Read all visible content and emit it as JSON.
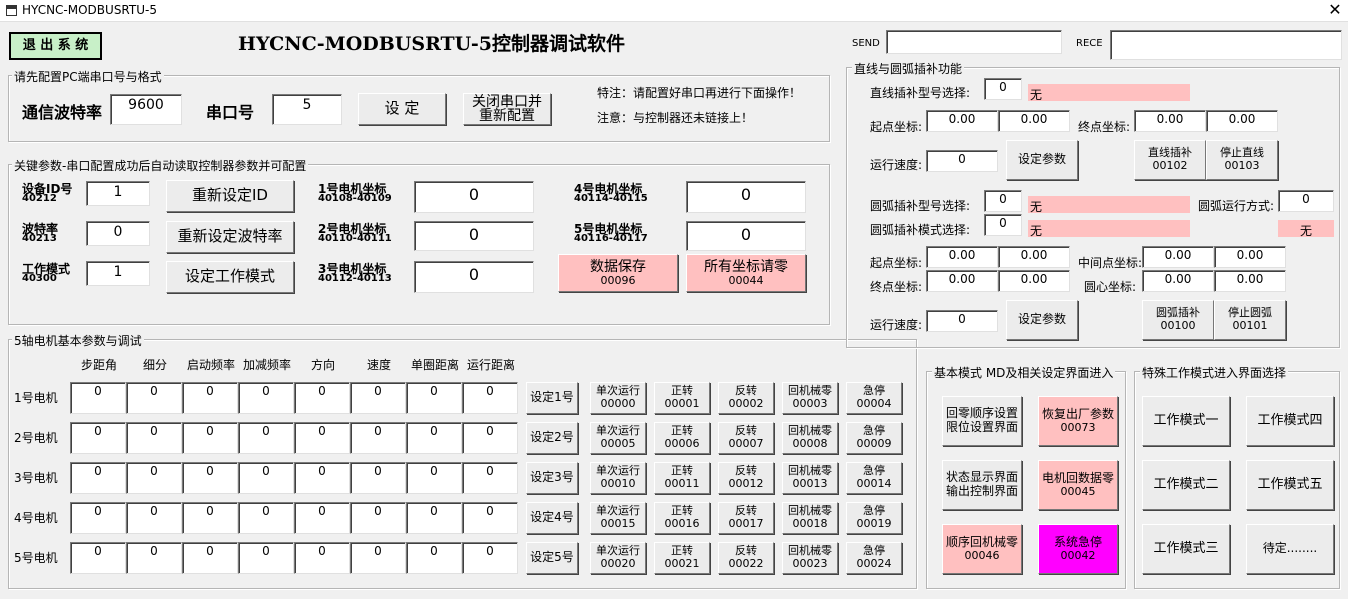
{
  "window": {
    "title": "HYCNC-MODBUSRTU-5",
    "close": "✕"
  },
  "header": {
    "exit": "退 出 系 统",
    "app_title": "HYCNC-MODBUSRTU-5控制器调试软件",
    "send": "SEND",
    "rece": "RECE"
  },
  "serial": {
    "group": "请先配置PC端串口号与格式",
    "baud_label": "通信波特率",
    "baud_value": "9600",
    "port_label": "串口号",
    "port_value": "5",
    "set_btn": "设 定",
    "close_btn_l1": "关闭串口并",
    "close_btn_l2": "重新配置",
    "note1": "特注：请配置好串口再进行下面操作！",
    "note2": "注意：与控制器还未链接上！"
  },
  "keyparams": {
    "group": "关键参数-串口配置成功后自动读取控制器参数并可配置",
    "id_label": "设备ID号",
    "id_reg": "40212",
    "id_value": "1",
    "id_btn": "重新设定ID",
    "baud_label": "波特率",
    "baud_reg": "40213",
    "baud_value": "0",
    "baud_btn": "重新设定波特率",
    "mode_label": "工作模式",
    "mode_reg": "40300",
    "mode_value": "1",
    "mode_btn": "设定工作模式",
    "m1_label": "1号电机坐标",
    "m1_reg": "40108-40109",
    "m1_value": "0",
    "m2_label": "2号电机坐标",
    "m2_reg": "40110-40111",
    "m2_value": "0",
    "m3_label": "3号电机坐标",
    "m3_reg": "40112-40113",
    "m3_value": "0",
    "m4_label": "4号电机坐标",
    "m4_reg": "40114-40115",
    "m4_value": "0",
    "m5_label": "5号电机坐标",
    "m5_reg": "40116-40117",
    "m5_value": "0",
    "save_btn": "数据保存",
    "save_code": "00096",
    "zero_btn": "所有坐标请零",
    "zero_code": "00044"
  },
  "axis": {
    "group": "5轴电机基本参数与调试",
    "headers": [
      "步距角",
      "细分",
      "启动频率",
      "加减频率",
      "方向",
      "速度",
      "单圈距离",
      "运行距离"
    ],
    "rows": [
      {
        "label": "1号电机",
        "values": [
          "0",
          "0",
          "0",
          "0",
          "0",
          "0",
          "0",
          "0"
        ],
        "set": "设定1号",
        "b1": "单次运行",
        "c1": "00000",
        "b2": "正转",
        "c2": "00001",
        "b3": "反转",
        "c3": "00002",
        "b4": "回机械零",
        "c4": "00003",
        "b5": "急停",
        "c5": "00004"
      },
      {
        "label": "2号电机",
        "values": [
          "0",
          "0",
          "0",
          "0",
          "0",
          "0",
          "0",
          "0"
        ],
        "set": "设定2号",
        "b1": "单次运行",
        "c1": "00005",
        "b2": "正转",
        "c2": "00006",
        "b3": "反转",
        "c3": "00007",
        "b4": "回机械零",
        "c4": "00008",
        "b5": "急停",
        "c5": "00009"
      },
      {
        "label": "3号电机",
        "values": [
          "0",
          "0",
          "0",
          "0",
          "0",
          "0",
          "0",
          "0"
        ],
        "set": "设定3号",
        "b1": "单次运行",
        "c1": "00010",
        "b2": "正转",
        "c2": "00011",
        "b3": "反转",
        "c3": "00012",
        "b4": "回机械零",
        "c4": "00013",
        "b5": "急停",
        "c5": "00014"
      },
      {
        "label": "4号电机",
        "values": [
          "0",
          "0",
          "0",
          "0",
          "0",
          "0",
          "0",
          "0"
        ],
        "set": "设定4号",
        "b1": "单次运行",
        "c1": "00015",
        "b2": "正转",
        "c2": "00016",
        "b3": "反转",
        "c3": "00017",
        "b4": "回机械零",
        "c4": "00018",
        "b5": "急停",
        "c5": "00019"
      },
      {
        "label": "5号电机",
        "values": [
          "0",
          "0",
          "0",
          "0",
          "0",
          "0",
          "0",
          "0"
        ],
        "set": "设定5号",
        "b1": "单次运行",
        "c1": "00020",
        "b2": "正转",
        "c2": "00021",
        "b3": "反转",
        "c3": "00022",
        "b4": "回机械零",
        "c4": "00023",
        "b5": "急停",
        "c5": "00024"
      }
    ]
  },
  "interp": {
    "group": "直线与圆弧插补功能",
    "line_type_label": "直线插补型号选择:",
    "line_type_value": "0",
    "line_type_text": "无",
    "start_label": "起点坐标:",
    "start_x": "0.00",
    "start_y": "0.00",
    "end_label": "终点坐标:",
    "end_x": "0.00",
    "end_y": "0.00",
    "speed_label": "运行速度:",
    "speed_value": "0",
    "setparam_btn": "设定参数",
    "line_btn": "直线插补",
    "line_code": "00102",
    "stopline_btn": "停止直线",
    "stopline_code": "00103",
    "arc_type_label": "圆弧插补型号选择:",
    "arc_type_value": "0",
    "arc_type_text": "无",
    "arc_mode_label": "圆弧插补模式选择:",
    "arc_mode_value": "0",
    "arc_mode_text": "无",
    "arc_run_label": "圆弧运行方式:",
    "arc_run_value": "0",
    "arc_run_text": "无",
    "arc_start_label": "起点坐标:",
    "arc_start_x": "0.00",
    "arc_start_y": "0.00",
    "arc_end_label": "终点坐标:",
    "arc_end_x": "0.00",
    "arc_end_y": "0.00",
    "arc_mid_label": "中间点坐标:",
    "arc_mid_x": "0.00",
    "arc_mid_y": "0.00",
    "arc_center_label": "圆心坐标:",
    "arc_center_x": "0.00",
    "arc_center_y": "0.00",
    "arc_speed_label": "运行速度:",
    "arc_speed_value": "0",
    "arc_setparam_btn": "设定参数",
    "arc_btn": "圆弧插补",
    "arc_code": "00100",
    "stoparc_btn": "停止圆弧",
    "stoparc_code": "00101"
  },
  "basic": {
    "group": "基本模式 MD及相关设定界面进入",
    "b1_l1": "回零顺序设置",
    "b1_l2": "限位设置界面",
    "b2_l1": "恢复出厂参数",
    "b2_code": "00073",
    "b3_l1": "状态显示界面",
    "b3_l2": "输出控制界面",
    "b4_l1": "电机回数据零",
    "b4_code": "00045",
    "b5_l1": "顺序回机械零",
    "b5_code": "00046",
    "b6_l1": "系统急停",
    "b6_code": "00042"
  },
  "special": {
    "group": "特殊工作模式进入界面选择",
    "m1": "工作模式一",
    "m2": "工作模式二",
    "m3": "工作模式三",
    "m4": "工作模式四",
    "m5": "工作模式五",
    "m6": "待定........"
  },
  "colors": {
    "pink": "#ffc0c0",
    "magenta": "#ff00ff",
    "exit_green": "#c8f0c8"
  }
}
